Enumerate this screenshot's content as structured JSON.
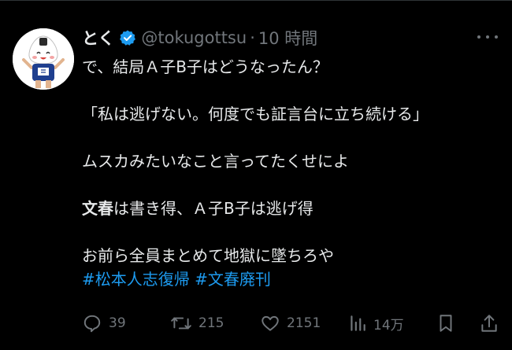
{
  "tweet": {
    "display_name": "とく",
    "handle": "@tokugottsu",
    "separator": "·",
    "timestamp": "10 時間",
    "lines": [
      "で、結局Ａ子B子はどうなったん？",
      "「私は逃げない。何度でも証言台に立ち続ける」",
      "ムスカみたいなこと言ってたくせによ",
      {
        "bold": "文春",
        "rest": "は書き得、Ａ子B子は逃げ得"
      },
      "お前ら全員まとめて地獄に墜ちろや"
    ],
    "hashtags": [
      "#松本人志復帰",
      "#文春廃刊"
    ]
  },
  "actions": {
    "replies": "39",
    "reposts": "215",
    "likes": "2151",
    "views": "14万"
  },
  "colors": {
    "background": "#000000",
    "text": "#e7e9ea",
    "secondary": "#71767b",
    "accent": "#1d9bf0"
  },
  "icons": [
    "verified-badge-icon",
    "more-icon",
    "reply-icon",
    "repost-icon",
    "like-icon",
    "views-icon",
    "bookmark-icon",
    "share-icon"
  ]
}
